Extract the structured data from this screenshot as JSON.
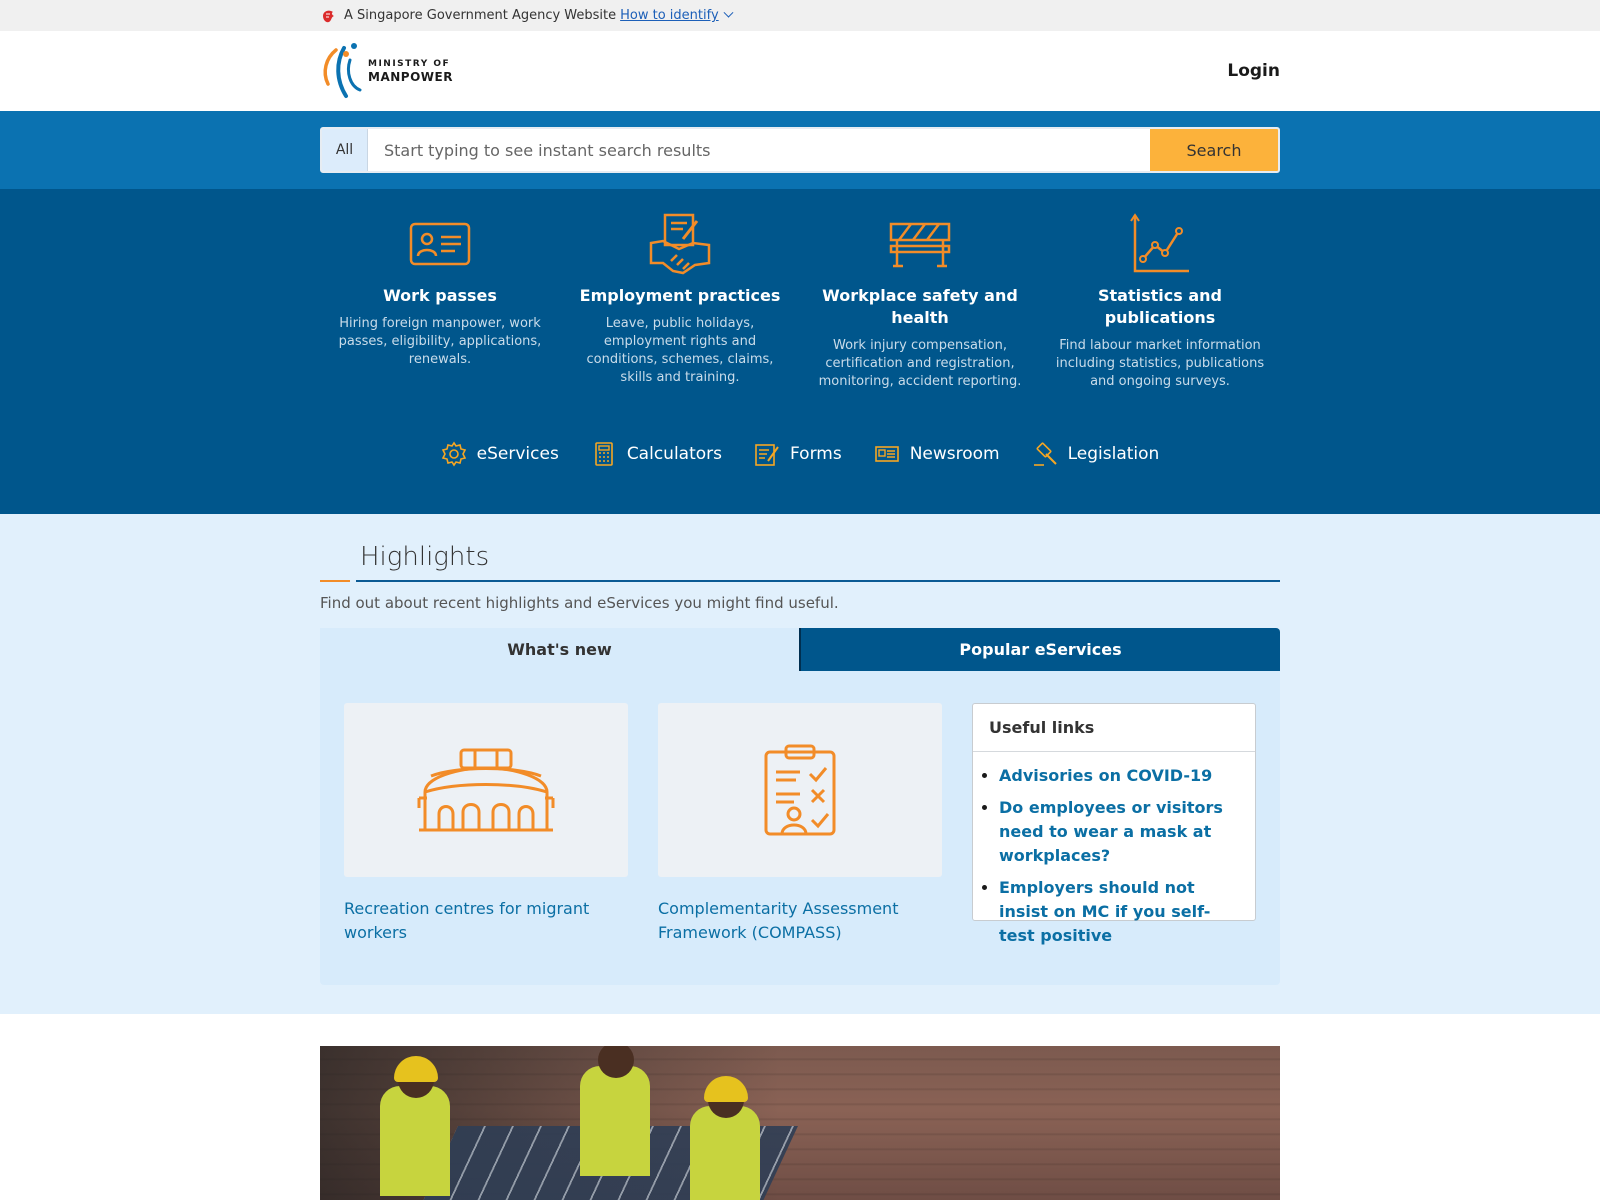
{
  "masthead": {
    "text": "A Singapore Government Agency Website",
    "link": "How to identify"
  },
  "header": {
    "logo_line1": "MINISTRY OF",
    "logo_line2": "MANPOWER",
    "login": "Login"
  },
  "search": {
    "scope": "All",
    "placeholder": "Start typing to see instant search results",
    "button": "Search"
  },
  "categories": [
    {
      "icon": "id-card-icon",
      "title": "Work passes",
      "desc": "Hiring foreign manpower, work passes, eligibility, applications, renewals."
    },
    {
      "icon": "handshake-icon",
      "title": "Employment practices",
      "desc": "Leave, public holidays, employment rights and conditions, schemes, claims, skills and training."
    },
    {
      "icon": "barrier-icon",
      "title": "Workplace safety and health",
      "desc": "Work injury compensation, certification and registration, monitoring, accident reporting."
    },
    {
      "icon": "line-chart-icon",
      "title": "Statistics and publications",
      "desc": "Find labour market information including statistics, publications and ongoing surveys."
    }
  ],
  "quicklinks": [
    {
      "icon": "gear-icon",
      "label": "eServices"
    },
    {
      "icon": "calculator-icon",
      "label": "Calculators"
    },
    {
      "icon": "form-icon",
      "label": "Forms"
    },
    {
      "icon": "newspaper-icon",
      "label": "Newsroom"
    },
    {
      "icon": "gavel-icon",
      "label": "Legislation"
    }
  ],
  "highlights": {
    "title": "Highlights",
    "subtitle": "Find out about recent highlights and eServices you might find useful.",
    "tabs": [
      "What's new",
      "Popular eServices"
    ],
    "cards": [
      {
        "icon": "stadium-icon",
        "label": "Recreation centres for migrant workers"
      },
      {
        "icon": "clipboard-checklist-icon",
        "label": "Complementarity Assessment Framework (COMPASS)"
      }
    ],
    "useful": {
      "title": "Useful links",
      "links": [
        "Advisories on COVID-19",
        "Do employees or visitors need to wear a mask at workplaces?",
        "Employers should not insist on MC if you self-test positive"
      ]
    }
  },
  "colors": {
    "brand_blue": "#0b72b1",
    "dark_blue": "#00568c",
    "accent_orange": "#f28c28",
    "search_button": "#fcb23b",
    "link": "#0b6fa4"
  }
}
